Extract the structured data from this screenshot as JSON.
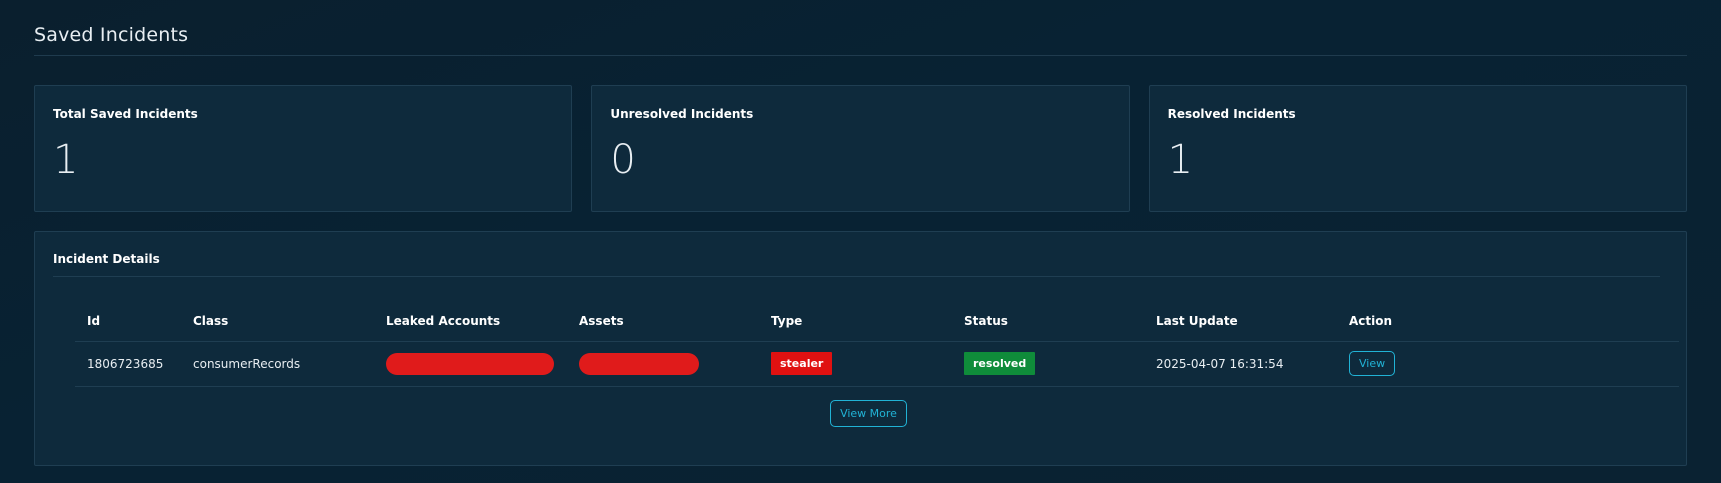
{
  "page": {
    "title": "Saved Incidents"
  },
  "cards": [
    {
      "label": "Total Saved Incidents",
      "value": "1"
    },
    {
      "label": "Unresolved Incidents",
      "value": "0"
    },
    {
      "label": "Resolved Incidents",
      "value": "1"
    }
  ],
  "details": {
    "title": "Incident Details",
    "columns": [
      "Id",
      "Class",
      "Leaked Accounts",
      "Assets",
      "Type",
      "Status",
      "Last Update",
      "Action"
    ],
    "rows": [
      {
        "id": "1806723685",
        "class": "consumerRecords",
        "type": "stealer",
        "status": "resolved",
        "last_update": "2025-04-07 16:31:54",
        "action": "View"
      }
    ],
    "view_more": "View More"
  },
  "colors": {
    "redaction": "#e01b1b",
    "type_badge": "#e01111",
    "status_badge": "#0f8c3a",
    "accent": "#21b3d6"
  }
}
